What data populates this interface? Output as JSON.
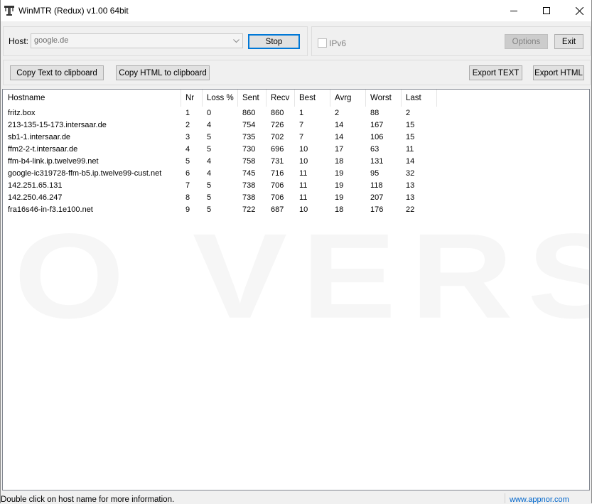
{
  "window": {
    "title": "WinMTR (Redux) v1.00 64bit"
  },
  "host": {
    "label": "Host:",
    "value": "google.de",
    "stop_label": "Stop",
    "ipv6_label": "IPv6",
    "ipv6_checked": false,
    "options_label": "Options",
    "exit_label": "Exit"
  },
  "toolbar": {
    "copy_text_label": "Copy Text to clipboard",
    "copy_html_label": "Copy HTML to clipboard",
    "export_text_label": "Export TEXT",
    "export_html_label": "Export HTML"
  },
  "table": {
    "columns": [
      "Hostname",
      "Nr",
      "Loss %",
      "Sent",
      "Recv",
      "Best",
      "Avrg",
      "Worst",
      "Last"
    ],
    "rows": [
      [
        "fritz.box",
        "1",
        "0",
        "860",
        "860",
        "1",
        "2",
        "88",
        "2"
      ],
      [
        "213-135-15-173.intersaar.de",
        "2",
        "4",
        "754",
        "726",
        "7",
        "14",
        "167",
        "15"
      ],
      [
        "sb1-1.intersaar.de",
        "3",
        "5",
        "735",
        "702",
        "7",
        "14",
        "106",
        "15"
      ],
      [
        "ffm2-2-t.intersaar.de",
        "4",
        "5",
        "730",
        "696",
        "10",
        "17",
        "63",
        "11"
      ],
      [
        "ffm-b4-link.ip.twelve99.net",
        "5",
        "4",
        "758",
        "731",
        "10",
        "18",
        "131",
        "14"
      ],
      [
        "google-ic319728-ffm-b5.ip.twelve99-cust.net",
        "6",
        "4",
        "745",
        "716",
        "11",
        "19",
        "95",
        "32"
      ],
      [
        "142.251.65.131",
        "7",
        "5",
        "738",
        "706",
        "11",
        "19",
        "118",
        "13"
      ],
      [
        "142.250.46.247",
        "8",
        "5",
        "738",
        "706",
        "11",
        "19",
        "207",
        "13"
      ],
      [
        "fra16s46-in-f3.1e100.net",
        "9",
        "5",
        "722",
        "687",
        "10",
        "18",
        "176",
        "22"
      ]
    ]
  },
  "status": {
    "message": "Double click on host name for more information.",
    "link": "www.appnor.com"
  },
  "icons": {
    "app": "winmtr-app-icon",
    "minimize": "minimize-icon",
    "maximize": "maximize-icon",
    "close": "close-icon",
    "dropdown": "chevron-down-icon"
  },
  "colors": {
    "default_button_border": "#0078d7",
    "link": "#0066cc",
    "disabled_text": "#838383"
  }
}
